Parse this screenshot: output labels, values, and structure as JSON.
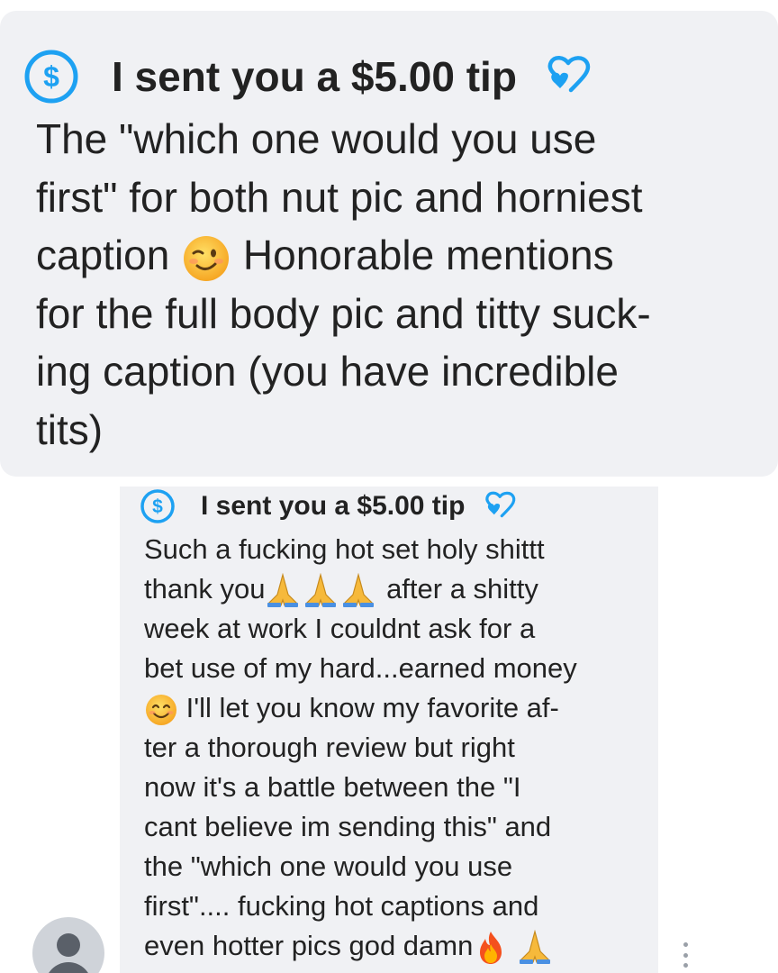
{
  "messages": [
    {
      "tip_label": "I sent you a $5.00 tip",
      "tip_icon": "dollar-circle-icon",
      "reaction_icon": "heart-outline-icon",
      "lines": [
        "The \"which one would you use",
        "first\" for both nut pic and horniest",
        "caption",
        "Honorable mentions",
        "for the full body pic and titty suck-",
        "ing caption (you have incredible",
        "tits)"
      ]
    },
    {
      "tip_label": "I sent you a $5.00 tip",
      "tip_icon": "dollar-circle-icon",
      "reaction_icon": "heart-outline-icon",
      "lines": [
        "Such a fucking hot set holy shittt",
        "thank you",
        "after a shitty",
        "week at work I couldnt ask for a",
        "bet use of my hard...earned money",
        "I'll let you know my favorite af-",
        "ter a thorough review but right",
        "now it's a battle between the \"I",
        "cant believe im sending this\" and",
        "the \"which one would you use",
        "first\".... fucking hot captions and",
        "even hotter pics god damn"
      ]
    }
  ],
  "colors": {
    "bubble": "#f0f1f4",
    "accent": "#1da1f2",
    "text": "#222222"
  }
}
